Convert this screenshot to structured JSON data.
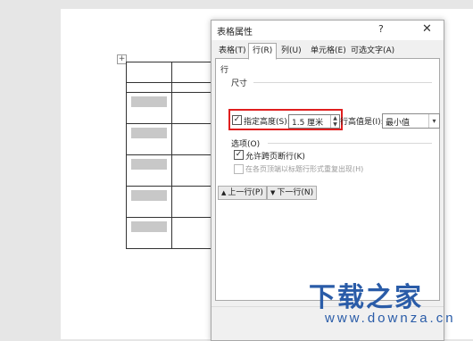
{
  "document": {
    "table_handle_symbol": "+",
    "row_count": 7
  },
  "dialog": {
    "title": "表格属性",
    "help": "?",
    "close": "✕",
    "tabs": [
      {
        "label": "表格(T)",
        "active": false
      },
      {
        "label": "行(R)",
        "active": true
      },
      {
        "label": "列(U)",
        "active": false
      },
      {
        "label": "单元格(E)",
        "active": false
      },
      {
        "label": "可选文字(A)",
        "active": false
      }
    ],
    "row_section": "行",
    "size_section": "尺寸",
    "specify_height": {
      "label": "指定高度(S):",
      "checked": true,
      "value": "1.5 厘米"
    },
    "row_height_is": {
      "label": "行高值是(I):",
      "value": "最小值"
    },
    "options_section": "选项(O)",
    "allow_break": {
      "label": "允许跨页断行(K)",
      "checked": true
    },
    "repeat_header": {
      "label": "在各页顶端以标题行形式重复出现(H)",
      "checked": false,
      "disabled": true
    },
    "prev_row": "上一行(P)",
    "next_row": "下一行(N)"
  },
  "watermark": {
    "logo": "下载之家",
    "url": "www.downza.cn"
  },
  "colors": {
    "highlight_box": "#e01f1f",
    "watermark": "#2a5ca8"
  }
}
